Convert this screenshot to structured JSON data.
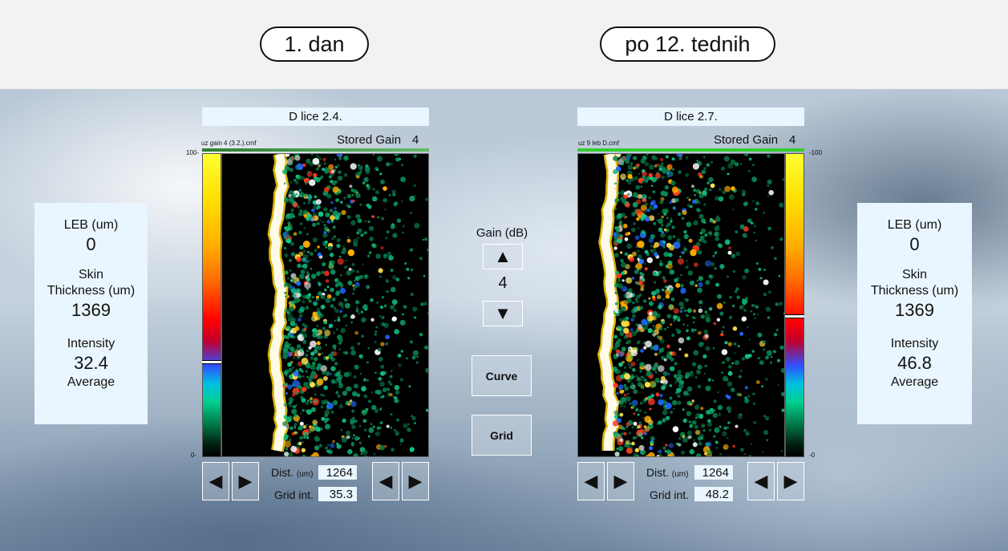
{
  "header": {
    "left_label": "1. dan",
    "right_label": "po 12. tednih"
  },
  "left_scan": {
    "title": "D lice 2.4.",
    "file": "uz gain 4 (3.2.).cmf",
    "stored_gain_label": "Stored Gain",
    "stored_gain_value": "4",
    "scale_top": "100-",
    "scale_bottom": "0-",
    "gain_marker_level": 0.32,
    "dist_label": "Dist.",
    "dist_unit": "(um)",
    "dist_value": "1264",
    "grid_label": "Grid int.",
    "grid_value": "35.3"
  },
  "right_scan": {
    "title": "D lice 2.7.",
    "file": "uz 9 leb D.cmf",
    "stored_gain_label": "Stored Gain",
    "stored_gain_value": "4",
    "scale_top": "-100",
    "scale_bottom": "-0",
    "gain_marker_level": 0.47,
    "dist_label": "Dist.",
    "dist_unit": "(um)",
    "dist_value": "1264",
    "grid_label": "Grid int.",
    "grid_value": "48.2"
  },
  "left_panel": {
    "leb_label": "LEB (um)",
    "leb_value": "0",
    "skin_label_1": "Skin",
    "skin_label_2": "Thickness (um)",
    "skin_value": "1369",
    "intensity_label": "Intensity",
    "intensity_value": "32.4",
    "average_label": "Average"
  },
  "right_panel": {
    "leb_label": "LEB (um)",
    "leb_value": "0",
    "skin_label_1": "Skin",
    "skin_label_2": "Thickness (um)",
    "skin_value": "1369",
    "intensity_label": "Intensity",
    "intensity_value": "46.8",
    "average_label": "Average"
  },
  "controls": {
    "gain_label": "Gain (dB)",
    "gain_value": "4",
    "curve_label": "Curve",
    "grid_label": "Grid"
  },
  "icons": {
    "up": "▲",
    "down": "▼",
    "left": "◀",
    "right": "▶"
  },
  "colors": {
    "panel_bg": "#eaf6ff",
    "gain_bar_green": "#33cc33"
  }
}
